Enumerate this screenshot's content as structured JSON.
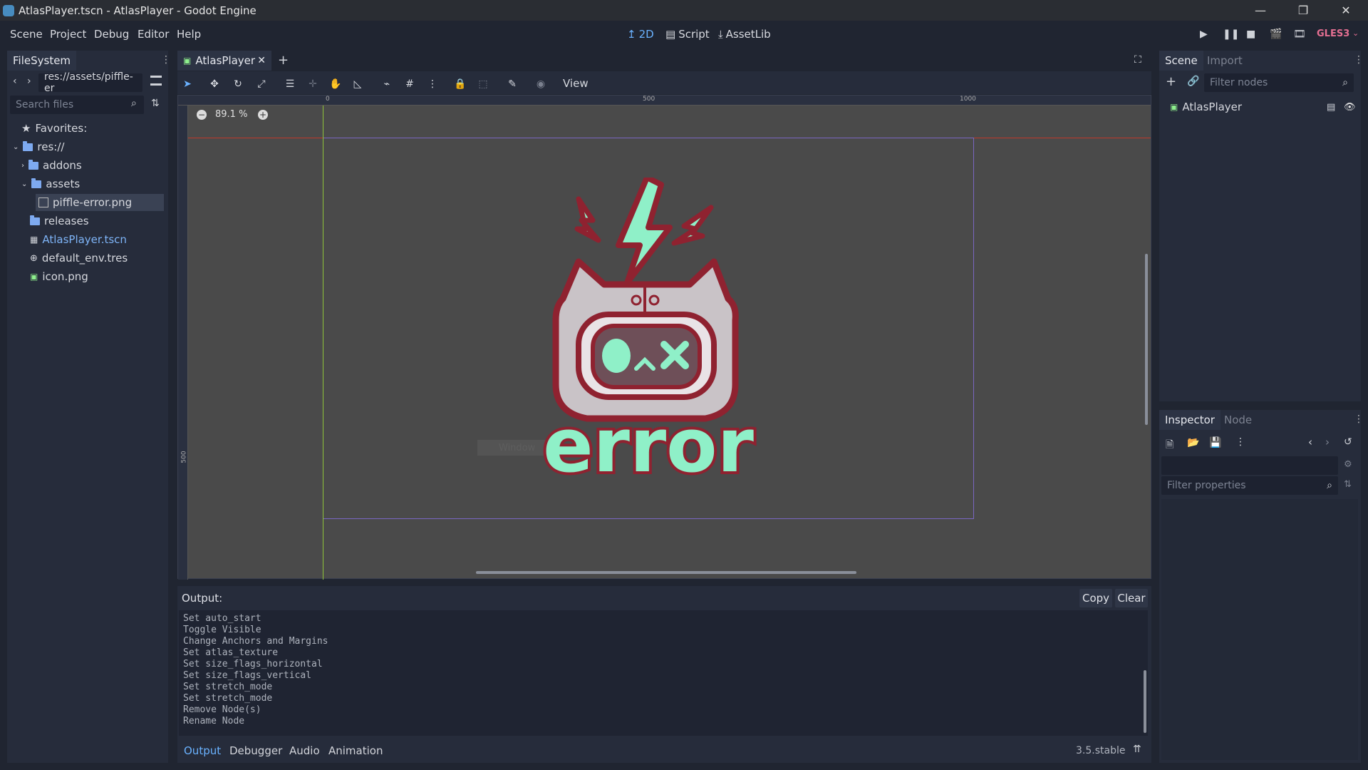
{
  "window": {
    "title": "AtlasPlayer.tscn - AtlasPlayer - Godot Engine"
  },
  "menu": [
    "Scene",
    "Project",
    "Debug",
    "Editor",
    "Help"
  ],
  "workspaces": [
    {
      "label": "2D",
      "icon": "2d-icon",
      "active": true
    },
    {
      "label": "Script",
      "icon": "script-icon",
      "active": false
    },
    {
      "label": "AssetLib",
      "icon": "assetlib-icon",
      "active": false
    }
  ],
  "renderer": "GLES3",
  "filesystem": {
    "tab": "FileSystem",
    "path": "res://assets/piffle-er",
    "search_placeholder": "Search files",
    "favorites_label": "Favorites:",
    "tree": [
      {
        "label": "res://",
        "type": "folder",
        "depth": 0,
        "expanded": true
      },
      {
        "label": "addons",
        "type": "folder",
        "depth": 1,
        "expanded": false
      },
      {
        "label": "assets",
        "type": "folder",
        "depth": 1,
        "expanded": true
      },
      {
        "label": "piffle-error.png",
        "type": "image",
        "depth": 2,
        "selected": true
      },
      {
        "label": "releases",
        "type": "folder",
        "depth": 1
      },
      {
        "label": "AtlasPlayer.tscn",
        "type": "scene",
        "depth": 1,
        "highlight": true
      },
      {
        "label": "default_env.tres",
        "type": "env",
        "depth": 1
      },
      {
        "label": "icon.png",
        "type": "image",
        "depth": 1
      }
    ]
  },
  "editor": {
    "tab_label": "AtlasPlayer",
    "zoom": "89.1 %",
    "view_menu": "View",
    "ruler_labels": [
      "0",
      "500",
      "1000"
    ],
    "left_ruler_label": "500",
    "window_hint": "Window",
    "artwork_text": "error"
  },
  "output": {
    "label": "Output:",
    "copy_button": "Copy",
    "clear_button": "Clear",
    "lines": [
      "Set auto_start",
      "Toggle Visible",
      "Change Anchors and Margins",
      "Set atlas_texture",
      "Set size_flags_horizontal",
      "Set size_flags_vertical",
      "Set stretch_mode",
      "Set stretch_mode",
      "Remove Node(s)",
      "Rename Node"
    ],
    "tabs": [
      "Output",
      "Debugger",
      "Audio",
      "Animation"
    ],
    "version": "3.5.stable"
  },
  "scene_dock": {
    "tabs": [
      "Scene",
      "Import"
    ],
    "filter_placeholder": "Filter nodes",
    "root_node": "AtlasPlayer"
  },
  "inspector": {
    "tabs": [
      "Inspector",
      "Node"
    ],
    "filter_placeholder": "Filter properties"
  },
  "colors": {
    "accent": "#6ab2ff",
    "renderer": "#e56f92",
    "background": "#202531",
    "panel": "#262c3b",
    "viewport": "#4a4a4a",
    "artwork_outline": "#8f2230",
    "artwork_mint": "#8ff0c8"
  }
}
